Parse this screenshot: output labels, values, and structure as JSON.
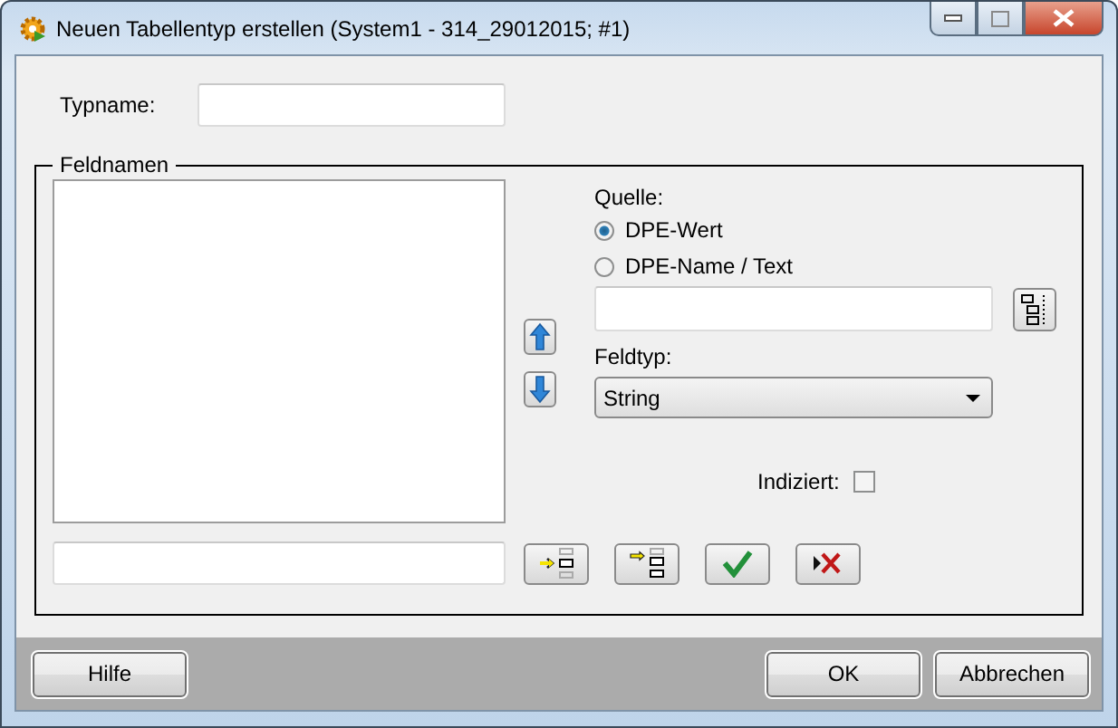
{
  "window": {
    "title": "Neuen Tabellentyp erstellen (System1 - 314_29012015; #1)"
  },
  "typname": {
    "label": "Typname:"
  },
  "feldnamen": {
    "title": "Feldnamen",
    "source": {
      "label": "Quelle:",
      "options": [
        {
          "label": "DPE-Wert",
          "selected": true
        },
        {
          "label": "DPE-Name / Text",
          "selected": false
        }
      ]
    },
    "feldtyp": {
      "label": "Feldtyp:",
      "value": "String"
    },
    "indiziert": {
      "label": "Indiziert:",
      "checked": false
    }
  },
  "buttons": [
    {
      "label": "Hilfe"
    },
    {
      "label": "OK"
    },
    {
      "label": "Abbrechen"
    }
  ]
}
